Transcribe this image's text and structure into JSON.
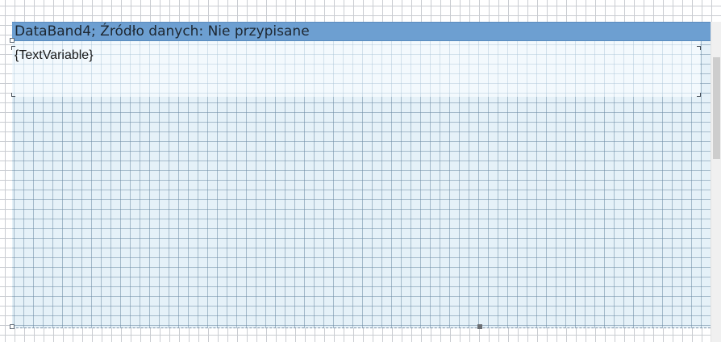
{
  "band": {
    "title": "DataBand4; Źródło danych: Nie przypisane",
    "text_field": "{TextVariable}"
  },
  "colors": {
    "band_header": "#6d9fd1",
    "band_area": "#e5f1f8",
    "band_body": "#f3f9fd",
    "grid_line": "#c9ccd1"
  }
}
